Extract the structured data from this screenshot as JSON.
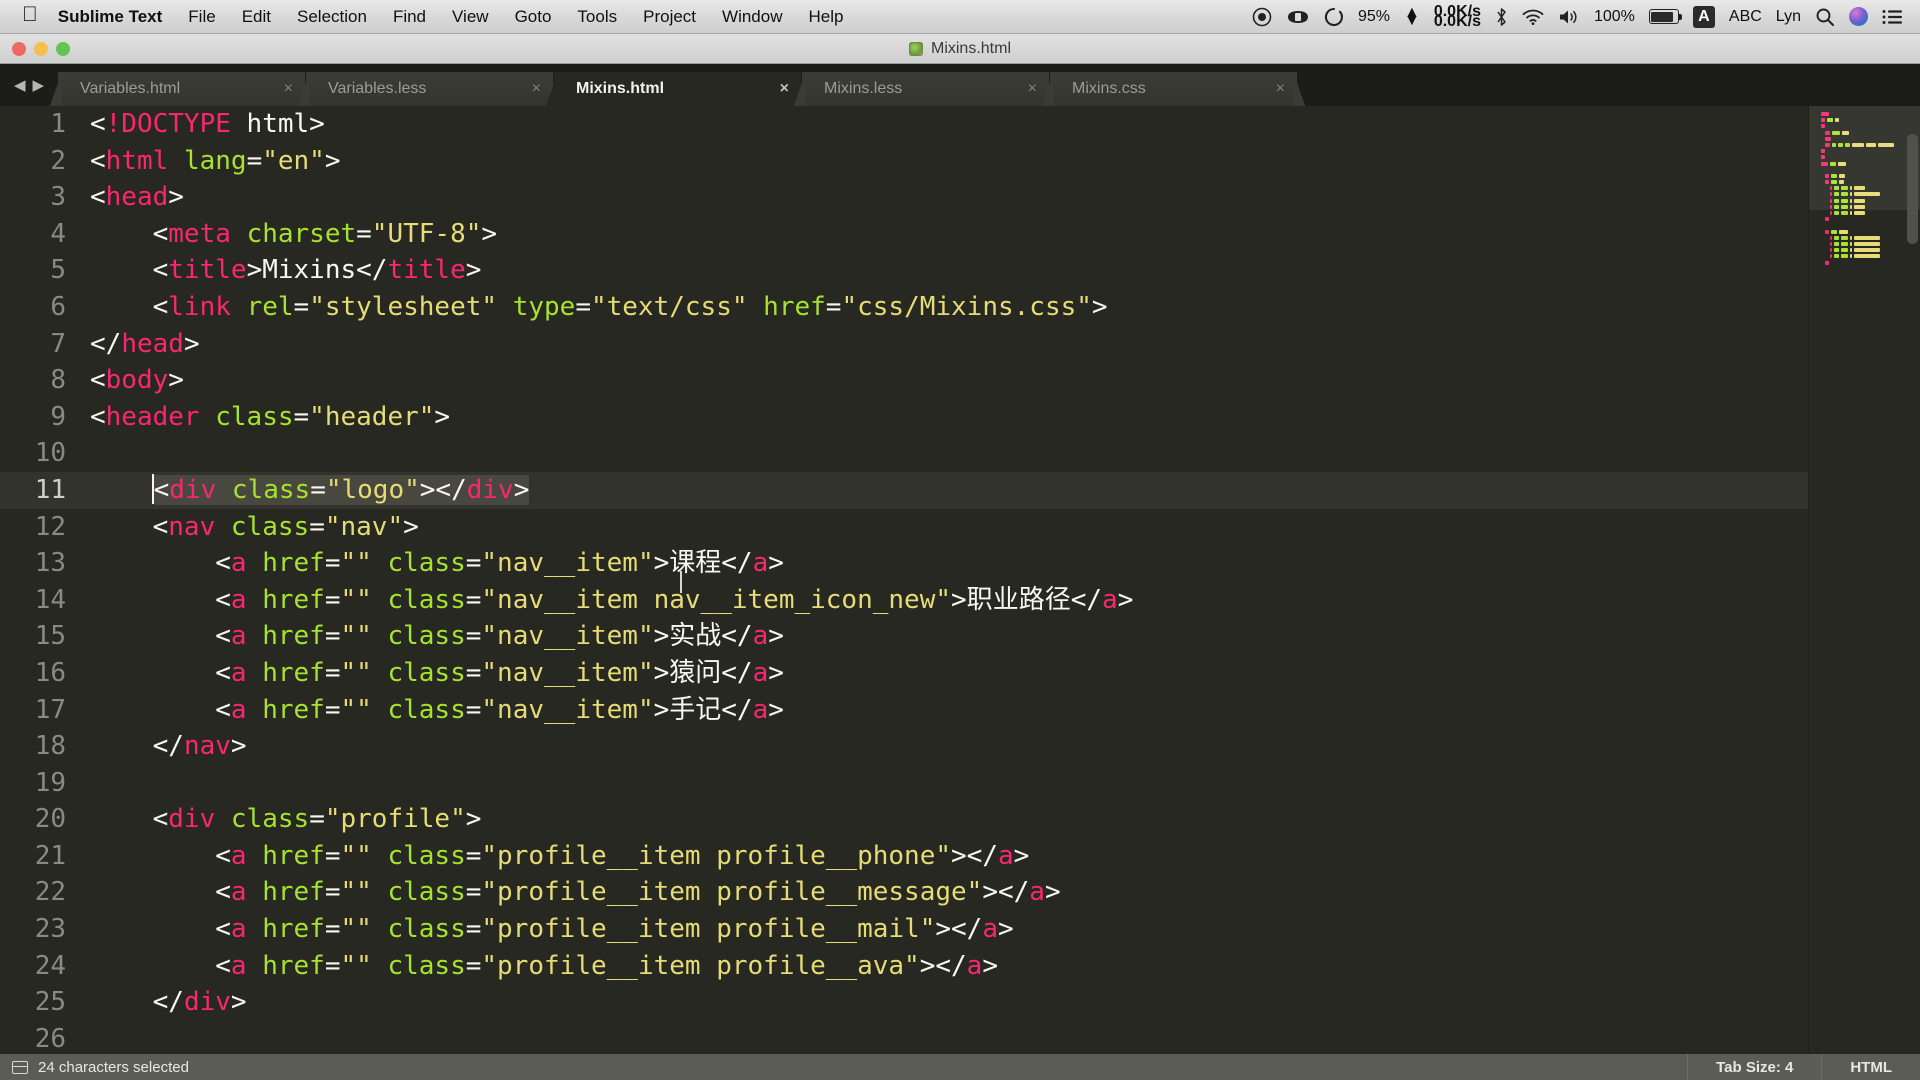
{
  "menubar": {
    "apple_glyph": "",
    "items": [
      "Sublime Text",
      "File",
      "Edit",
      "Selection",
      "Find",
      "View",
      "Goto",
      "Tools",
      "Project",
      "Window",
      "Help"
    ],
    "tray": {
      "record_icon": "record-icon",
      "cleaner_icon": "cleaner-icon",
      "spinner_icon": "spinner-icon",
      "cpu_percent": "95%",
      "net_up": "0.0K/s",
      "net_down": "0.0K/s",
      "bluetooth_icon": "bluetooth-icon",
      "wifi_icon": "wifi-icon",
      "volume_icon": "volume-icon",
      "battery_percent": "100%",
      "input_source": "A",
      "abc_label": "ABC",
      "lyn_label": "Lyn",
      "search_icon": "search-icon",
      "siri_icon": "siri-icon",
      "notification_icon": "notification-center-icon"
    }
  },
  "titlebar": {
    "document_title": "Mixins.html"
  },
  "tabbar": {
    "tabs": [
      {
        "label": "Variables.html",
        "close": "×",
        "active": false
      },
      {
        "label": "Variables.less",
        "close": "×",
        "active": false
      },
      {
        "label": "Mixins.html",
        "close": "×",
        "active": true
      },
      {
        "label": "Mixins.less",
        "close": "×",
        "active": false
      },
      {
        "label": "Mixins.css",
        "close": "×",
        "active": false
      }
    ]
  },
  "editor": {
    "language": "HTML",
    "selected_line": 11,
    "line_numbers": [
      "1",
      "2",
      "3",
      "4",
      "5",
      "6",
      "7",
      "8",
      "9",
      "10",
      "11",
      "12",
      "13",
      "14",
      "15",
      "16",
      "17",
      "18",
      "19",
      "20",
      "21",
      "22",
      "23",
      "24",
      "25",
      "26"
    ],
    "lines": [
      {
        "n": 1,
        "text": "<!DOCTYPE html>"
      },
      {
        "n": 2,
        "text": "<html lang=\"en\">"
      },
      {
        "n": 3,
        "text": "<head>"
      },
      {
        "n": 4,
        "text": "    <meta charset=\"UTF-8\">"
      },
      {
        "n": 5,
        "text": "    <title>Mixins</title>"
      },
      {
        "n": 6,
        "text": "    <link rel=\"stylesheet\" type=\"text/css\" href=\"css/Mixins.css\">"
      },
      {
        "n": 7,
        "text": "</head>"
      },
      {
        "n": 8,
        "text": "<body>"
      },
      {
        "n": 9,
        "text": "<header class=\"header\">"
      },
      {
        "n": 10,
        "text": ""
      },
      {
        "n": 11,
        "text": "    <div class=\"logo\"></div>"
      },
      {
        "n": 12,
        "text": "    <nav class=\"nav\">"
      },
      {
        "n": 13,
        "text": "        <a href=\"\" class=\"nav__item\">课程</a>"
      },
      {
        "n": 14,
        "text": "        <a href=\"\" class=\"nav__item nav__item_icon_new\">职业路径</a>"
      },
      {
        "n": 15,
        "text": "        <a href=\"\" class=\"nav__item\">实战</a>"
      },
      {
        "n": 16,
        "text": "        <a href=\"\" class=\"nav__item\">猿问</a>"
      },
      {
        "n": 17,
        "text": "        <a href=\"\" class=\"nav__item\">手记</a>"
      },
      {
        "n": 18,
        "text": "    </nav>"
      },
      {
        "n": 19,
        "text": ""
      },
      {
        "n": 20,
        "text": "    <div class=\"profile\">"
      },
      {
        "n": 21,
        "text": "        <a href=\"\" class=\"profile__item profile__phone\"></a>"
      },
      {
        "n": 22,
        "text": "        <a href=\"\" class=\"profile__item profile__message\"></a>"
      },
      {
        "n": 23,
        "text": "        <a href=\"\" class=\"profile__item profile__mail\"></a>"
      },
      {
        "n": 24,
        "text": "        <a href=\"\" class=\"profile__item profile__ava\"></a>"
      },
      {
        "n": 25,
        "text": "    </div>"
      },
      {
        "n": 26,
        "text": ""
      }
    ],
    "selection_text": "<div class=\"logo\"></div>"
  },
  "statusbar": {
    "panel_icon": "panel-icon",
    "message": "24 characters selected",
    "tab_size": "Tab Size: 4",
    "syntax": "HTML"
  },
  "colors": {
    "editor_bg": "#272822",
    "tag": "#f92672",
    "attribute": "#a6e22e",
    "string": "#e6db74",
    "text": "#f8f8f2",
    "selection": "#49483e",
    "line_highlight": "#32332c",
    "gutter_text": "#8a8a80",
    "statusbar_bg": "#5b5c55",
    "tabbar_bg": "#1c1d18"
  }
}
